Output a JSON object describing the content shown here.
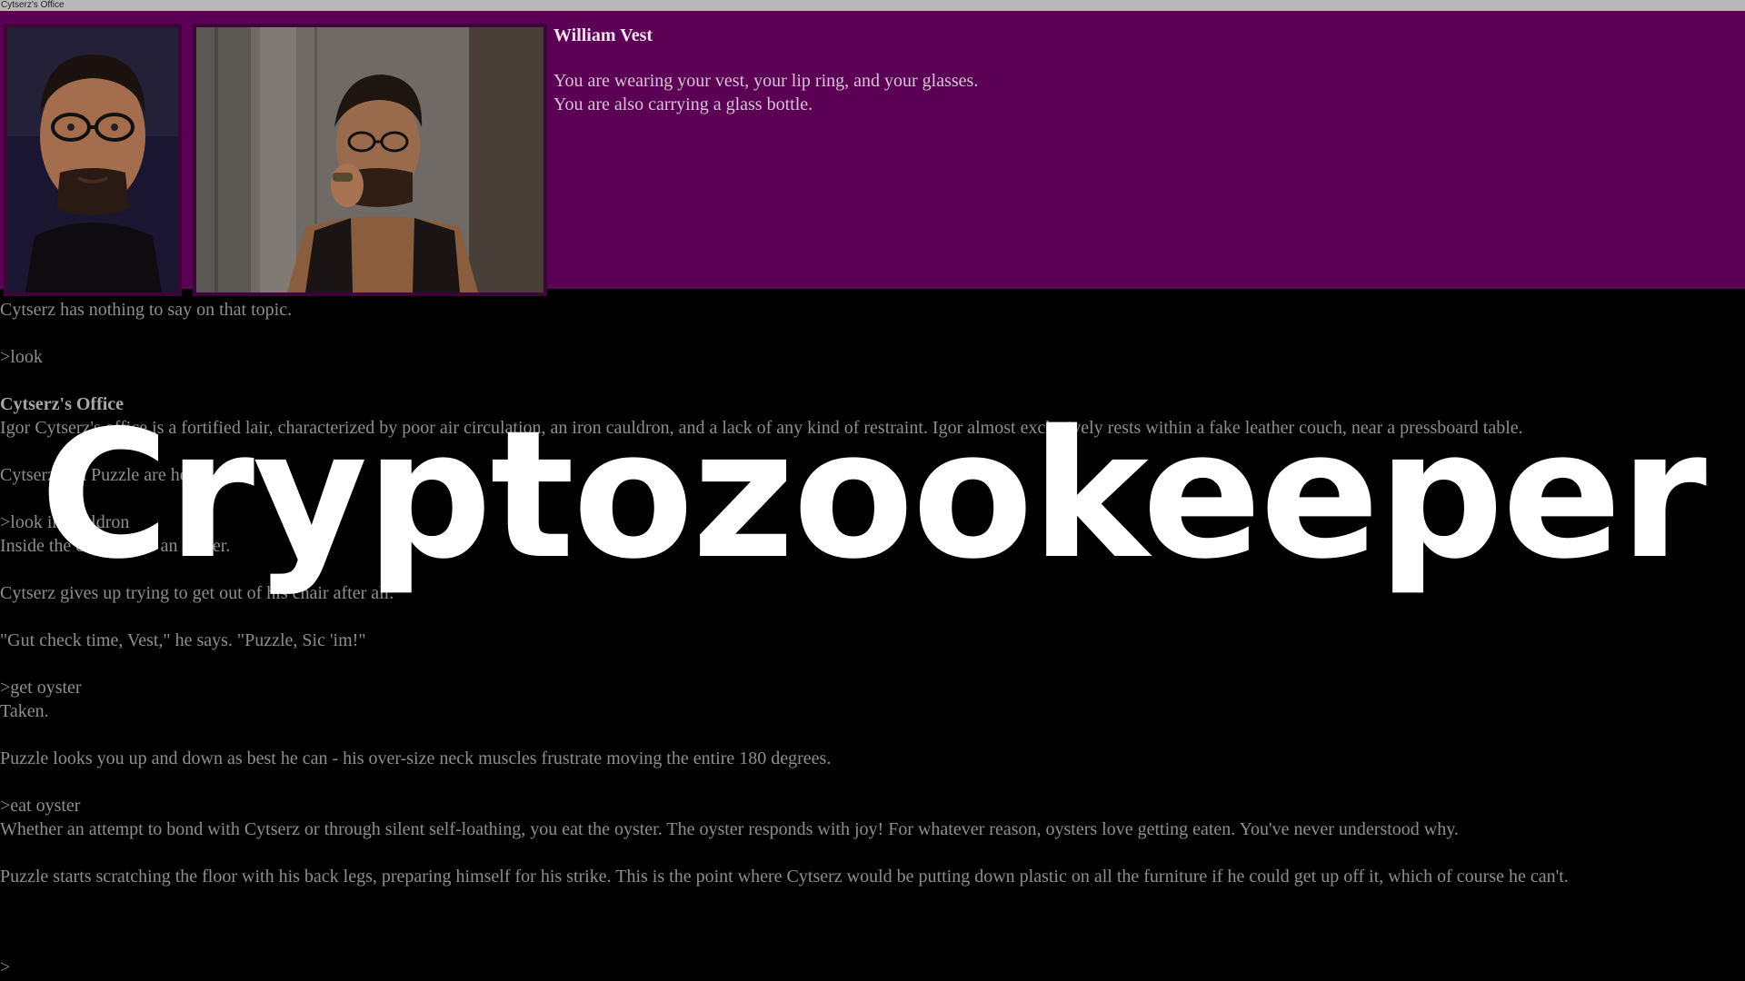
{
  "window": {
    "title": "Cytserz's Office"
  },
  "status": {
    "name": "William Vest",
    "line1": "You are wearing your vest, your lip ring, and your glasses.",
    "line2": "You are also carrying a glass bottle."
  },
  "transcript": [
    "Cytserz has nothing to say on that topic.",
    ">look",
    {
      "title": "Cytserz's Office",
      "body": "Igor Cytserz's office is a fortified lair, characterized by poor air circulation, an iron cauldron, and a lack of any kind of restraint. Igor almost exclusively rests within a fake leather couch, near a pressboard table."
    },
    "Cytserz and Puzzle are here.",
    {
      "command": ">look in cauldron",
      "response": "Inside the cauldron is an oyster."
    },
    "Cytserz gives up trying to get out of his chair after all.",
    "\"Gut check time, Vest,\" he says. \"Puzzle, Sic 'im!\"",
    {
      "command": ">get oyster",
      "response": "Taken."
    },
    "Puzzle looks you up and down as best he can - his over-size neck muscles frustrate moving the entire 180 degrees.",
    {
      "command": ">eat oyster",
      "response": "Whether an attempt to bond with Cytserz or through silent self-loathing, you eat the oyster. The oyster responds with joy! For whatever reason, oysters love getting eaten. You've never understood why."
    },
    "Puzzle starts scratching the floor with his back legs, preparing himself for his strike. This is the point where Cytserz would be putting down plastic on all the furniture if he could get up off it, which of course he can't."
  ],
  "prompt": ">",
  "overlay": {
    "title": "Cryptozookeeper"
  },
  "colors": {
    "status_bg": "#5c0055",
    "page_bg": "#000000",
    "text": "#8e8e8e",
    "overlay_text": "#ffffff"
  }
}
